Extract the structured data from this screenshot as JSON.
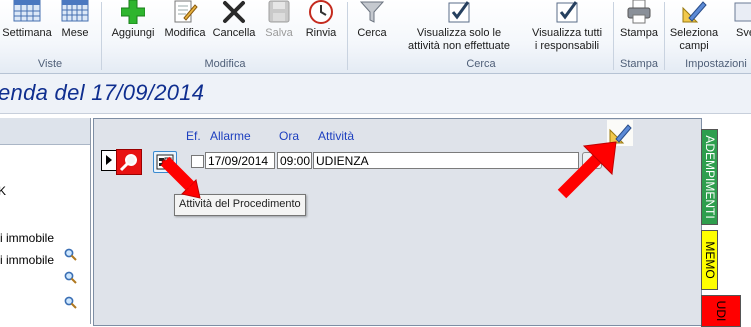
{
  "ribbon": {
    "groups": [
      {
        "label": "Viste"
      },
      {
        "label": "Modifica"
      },
      {
        "label": "Cerca"
      },
      {
        "label": "Stampa"
      },
      {
        "label": "Impostazioni"
      }
    ],
    "buttons": {
      "settimana": "Settimana",
      "mese": "Mese",
      "aggiungi": "Aggiungi",
      "modifica": "Modifica",
      "cancella": "Cancella",
      "salva": "Salva",
      "rinvia": "Rinvia",
      "cerca": "Cerca",
      "solo_non_effettuate": "Visualizza solo le\nattività non effettuate",
      "tutti_responsabili": "Visualizza tutti\ni responsabili",
      "stampa": "Stampa",
      "seleziona_campi": "Seleziona\ncampi",
      "sve": "Sve"
    }
  },
  "title": "enda del 17/09/2014",
  "left_panel": {
    "items": [
      "K",
      "i immobile",
      "i immobile"
    ]
  },
  "agenda": {
    "columns": {
      "ef": "Ef.",
      "allarme": "Allarme",
      "ora": "Ora",
      "attivita": "Attività"
    },
    "row": {
      "date": "17/09/2014",
      "time": "09:00",
      "activity": "UDIENZA",
      "done": false
    },
    "tooltip": "Attività del Procedimento"
  },
  "right_tabs": [
    {
      "label": "ADEMPIMENTI",
      "color": "#2e9e4e"
    },
    {
      "label": "MEMO",
      "color": "#ffff00"
    },
    {
      "label": "UDI",
      "color": "#ff0000"
    }
  ],
  "colors": {
    "title": "#0f2e8f",
    "header_text": "#1d3fbf",
    "arrow": "#ff0000"
  }
}
